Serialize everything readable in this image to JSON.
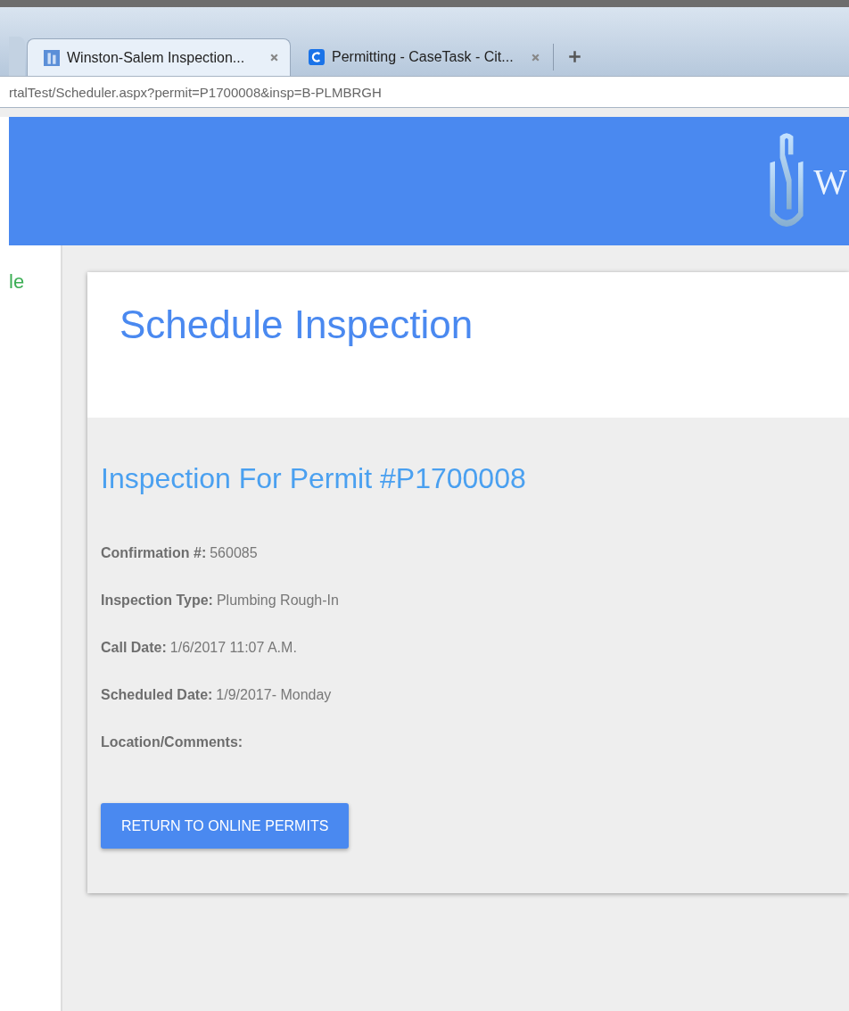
{
  "browser": {
    "tabs": [
      {
        "title": "Winston-Salem Inspection...",
        "kind": "city",
        "selected": true
      },
      {
        "title": "Permitting - CaseTask - Cit...",
        "kind": "letter",
        "selected": false
      }
    ],
    "url": "rtalTest/Scheduler.aspx?permit=P1700008&insp=B-PLMBRGH"
  },
  "header": {
    "logo_text": "W"
  },
  "sidebar": {
    "text": "le"
  },
  "card": {
    "title": "Schedule Inspection",
    "subtitle": "Inspection For Permit #P1700008",
    "fields": [
      {
        "label": "Confirmation #:",
        "value": "560085"
      },
      {
        "label": "Inspection Type:",
        "value": "Plumbing Rough-In"
      },
      {
        "label": "Call Date:",
        "value": "1/6/2017 11:07 A.M."
      },
      {
        "label": "Scheduled Date:",
        "value": "1/9/2017- Monday"
      },
      {
        "label": "Location/Comments:"
      }
    ],
    "button": "RETURN TO ONLINE PERMITS"
  }
}
